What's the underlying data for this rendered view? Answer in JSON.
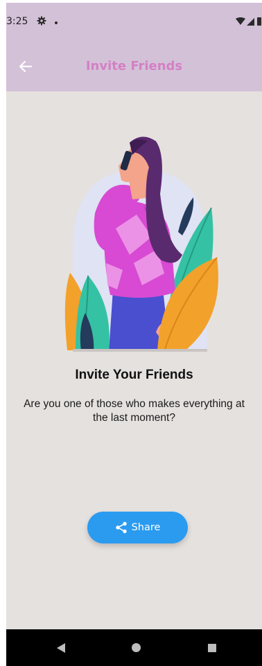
{
  "status_bar": {
    "time": "3:25",
    "icons": [
      "gear-icon",
      "notification-dot-icon",
      "wifi-icon",
      "signal-icon",
      "battery-icon"
    ]
  },
  "app_bar": {
    "title": "Invite Friends",
    "back_icon": "arrow-left-icon"
  },
  "content": {
    "heading": "Invite Your Friends",
    "description": "Are you one of those who makes everything at the last moment?"
  },
  "share_button": {
    "label": "Share",
    "icon": "share-icon"
  },
  "nav_bar": {
    "icons": [
      "nav-back-icon",
      "nav-home-icon",
      "nav-recents-icon"
    ]
  },
  "colors": {
    "app_bar_bg": "#d3c1d8",
    "title_color": "#d480c4",
    "page_bg": "#e5e1df",
    "button_bg": "#2b9bf0"
  }
}
